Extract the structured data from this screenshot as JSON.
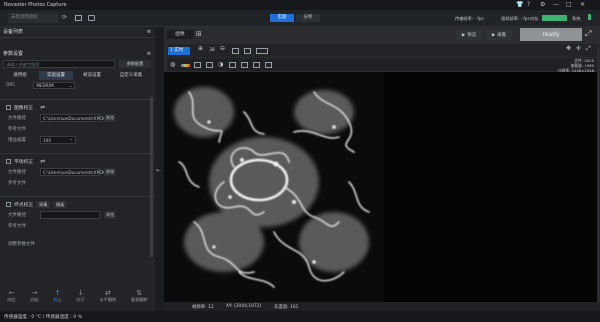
{
  "app": {
    "title": "Novaster Photos Capture"
  },
  "toolbar": {
    "device_placeholder": "未检测到相机",
    "mode_tabs": [
      {
        "label": "实验",
        "active": true
      },
      {
        "label": "分析",
        "active": false
      }
    ],
    "status_items": [
      "传输帧率: - fps",
      "相机帧率: - fps",
      "内存"
    ],
    "system_label": "系统",
    "accent": "#1f6fd8",
    "memory_color": "#3cb371"
  },
  "left_panel": {
    "device_list_title": "设备列表",
    "params_title": "参数设置",
    "search_placeholder": "请输入关键字搜索",
    "param_group_button": "参数配置",
    "tabs": [
      "通用组",
      "实验设置",
      "帧读设置",
      "自定义采集"
    ],
    "dpc": {
      "label": "DPC",
      "value": "MEDIUM"
    },
    "sections": [
      {
        "title": "图像校正",
        "file_path_label": "文件路径",
        "path": "C:\\Users\\ux\\Documents\\XPCIC",
        "browse": "浏览",
        "ref_label": "参考文件",
        "offset_label": "增益偏置",
        "offset_value": "100"
      },
      {
        "title": "平场校正",
        "file_path_label": "文件路径",
        "path": "C:\\Users\\ux\\Documents\\XPCIC",
        "browse": "浏览",
        "ref_label": "参考文件"
      },
      {
        "title": "坏点校正",
        "buttons": [
          "采集",
          "模板"
        ],
        "file_path_label": "文件路径",
        "browse": "浏览",
        "ref_label": "参考文件"
      }
    ],
    "footer_label": "调整参数文件",
    "arrows": [
      {
        "label": "向左",
        "glyph": "←",
        "active": false
      },
      {
        "label": "向右",
        "glyph": "→",
        "active": false
      },
      {
        "label": "向上",
        "glyph": "↑",
        "active": true
      },
      {
        "label": "向下",
        "glyph": "↓",
        "active": false
      },
      {
        "label": "水平翻转",
        "glyph": "⇄",
        "active": false
      },
      {
        "label": "垂直翻转",
        "glyph": "⇅",
        "active": false
      }
    ]
  },
  "viewer": {
    "image_tab": "图像",
    "preview_btn": "预览",
    "record_btn": "采集",
    "ready_text": "ready",
    "zoom_select": "1 实时",
    "zoom_pct": "38",
    "info_lines": [
      "文件: 0025",
      "加载量: 1960",
      "分辨率: 2048×2048"
    ],
    "footer": {
      "mode": "帧频率: 12",
      "coord": "XY: (2044,1972)",
      "value": "灰度值: 161"
    }
  },
  "status_bar": {
    "text": "传感器温度 : 0 °C / 传感器湿度 : 0 %"
  }
}
